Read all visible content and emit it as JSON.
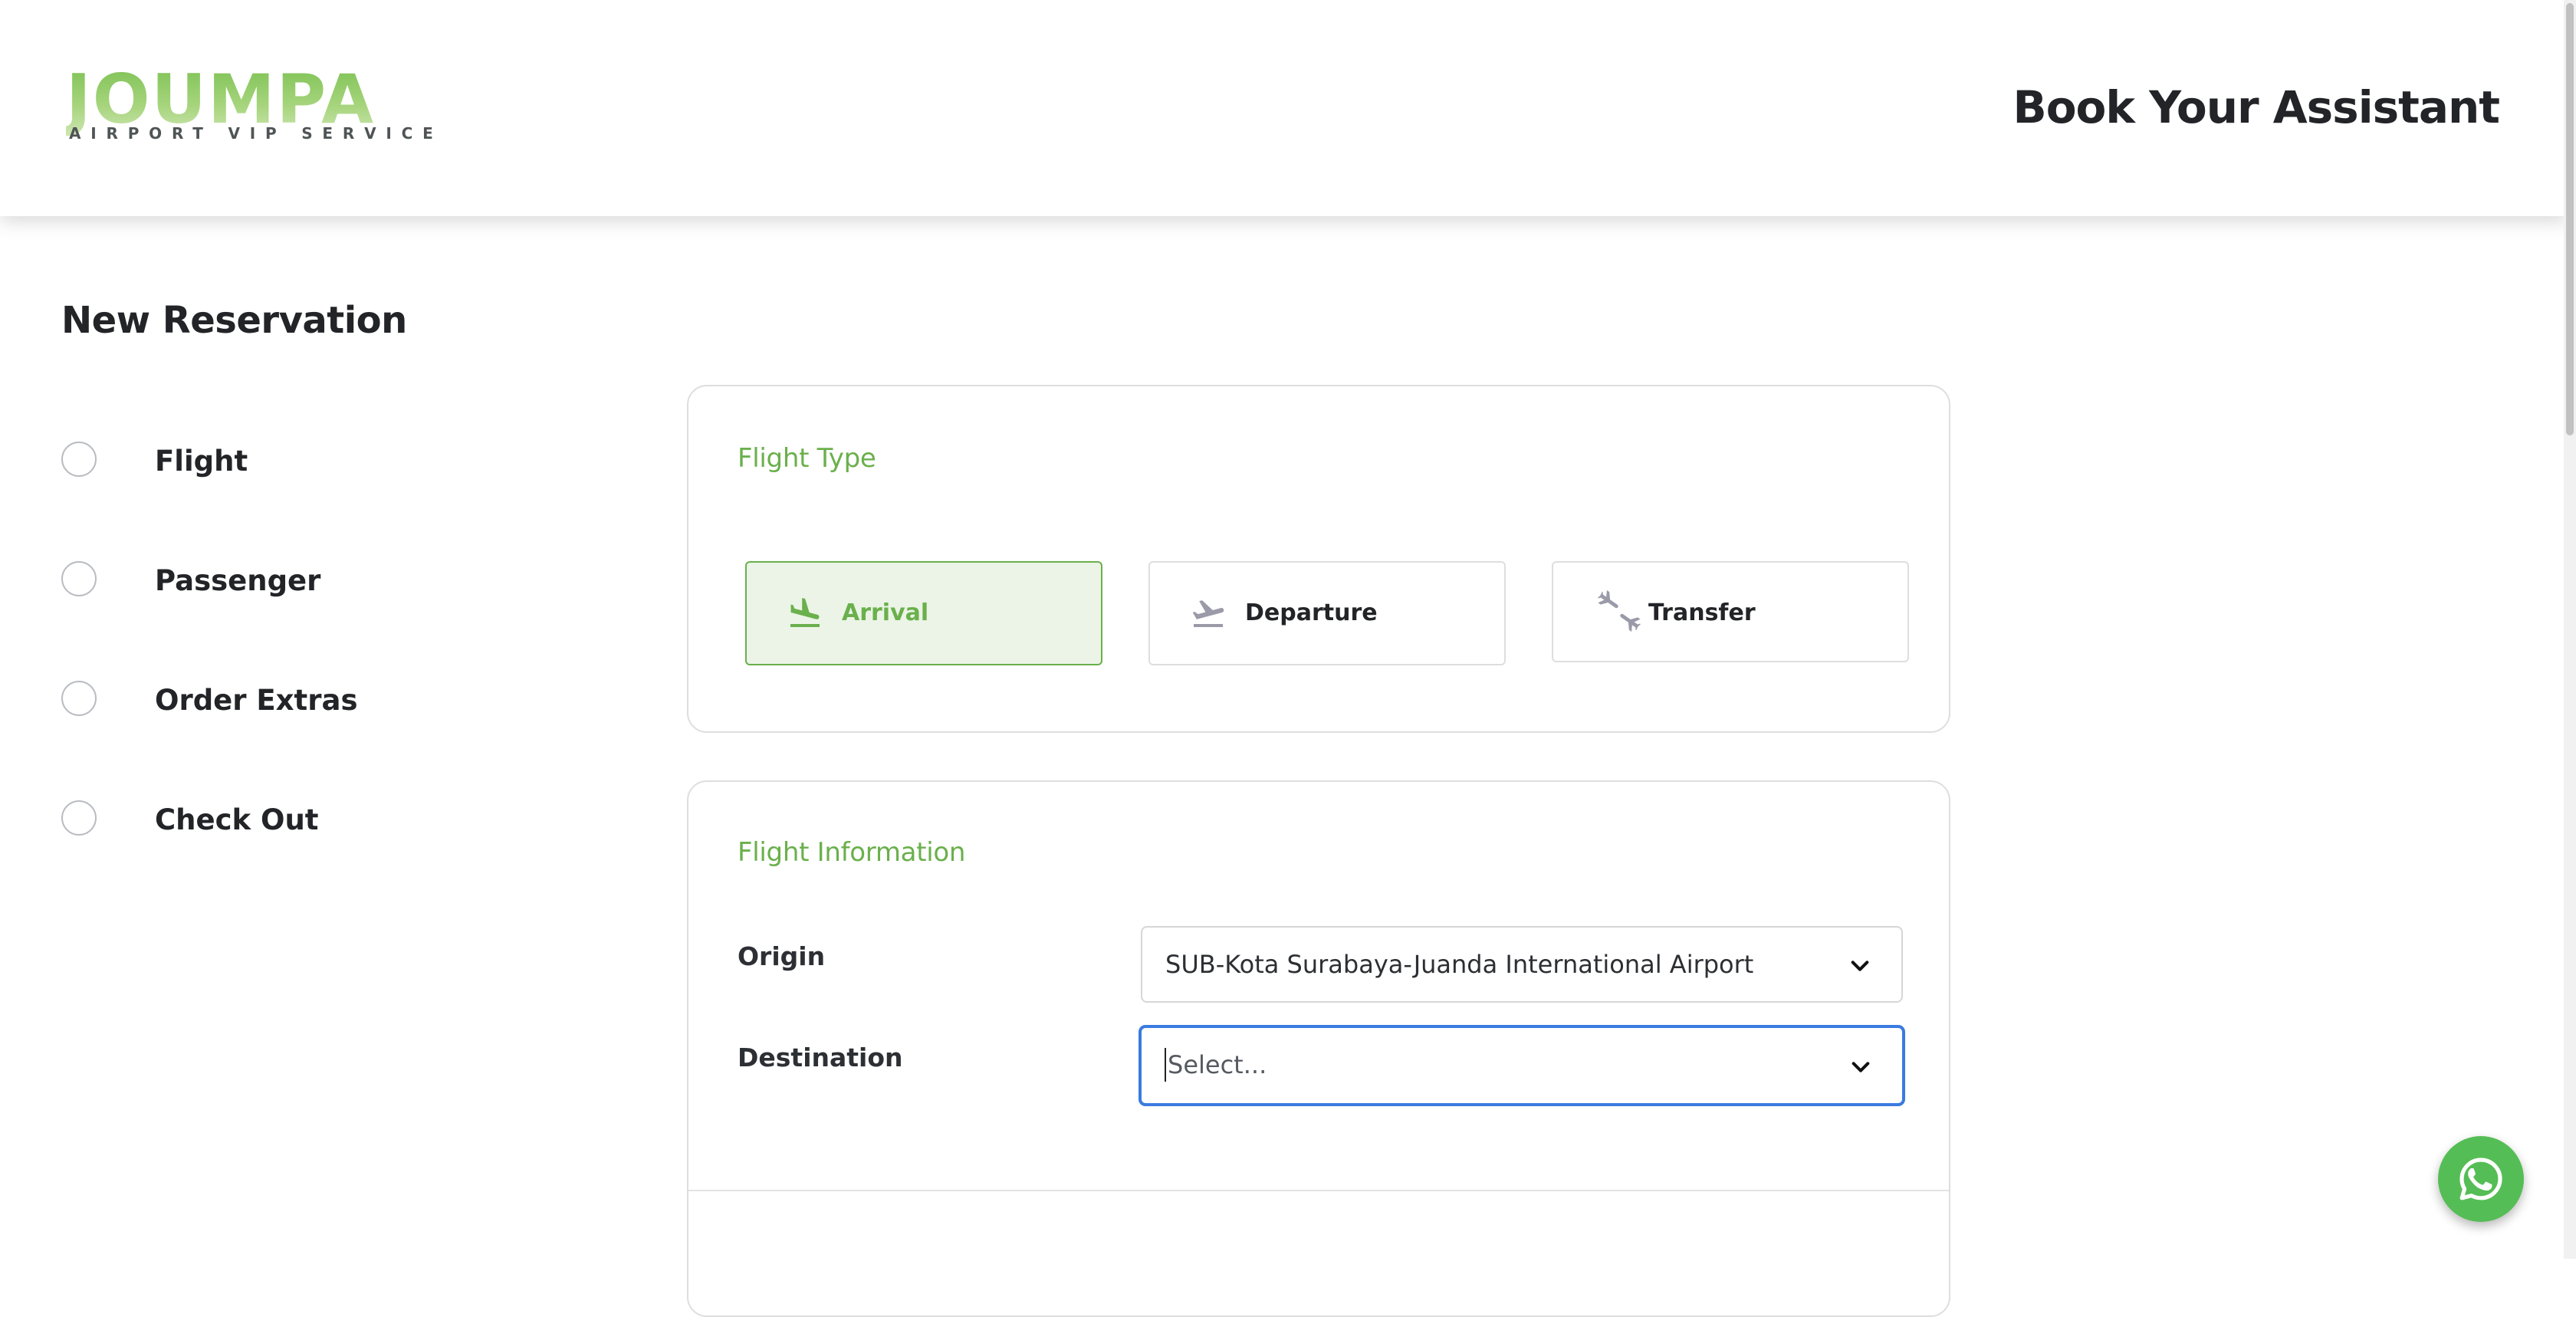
{
  "header": {
    "logo_text": "JOUMPA",
    "logo_tagline": "AIRPORT VIP SERVICE",
    "title": "Book Your Assistant"
  },
  "page": {
    "title": "New Reservation"
  },
  "steps": [
    {
      "label": "Flight"
    },
    {
      "label": "Passenger"
    },
    {
      "label": "Order Extras"
    },
    {
      "label": "Check Out"
    }
  ],
  "flight_type": {
    "heading": "Flight Type",
    "options": [
      {
        "label": "Arrival",
        "icon": "plane-arrival-icon",
        "selected": true
      },
      {
        "label": "Departure",
        "icon": "plane-departure-icon",
        "selected": false
      },
      {
        "label": "Transfer",
        "icon": "plane-transfer-icon",
        "selected": false
      }
    ]
  },
  "flight_info": {
    "heading": "Flight Information",
    "origin_label": "Origin",
    "origin_value": "SUB-Kota Surabaya-Juanda International Airport",
    "destination_label": "Destination",
    "destination_placeholder": "Select..."
  },
  "colors": {
    "brand_green": "#6ab04c",
    "selected_bg": "#ebf4e6",
    "focus_blue": "#3a7be0",
    "whatsapp_green": "#55bd55"
  },
  "floating": {
    "whatsapp_icon": "whatsapp-icon"
  }
}
